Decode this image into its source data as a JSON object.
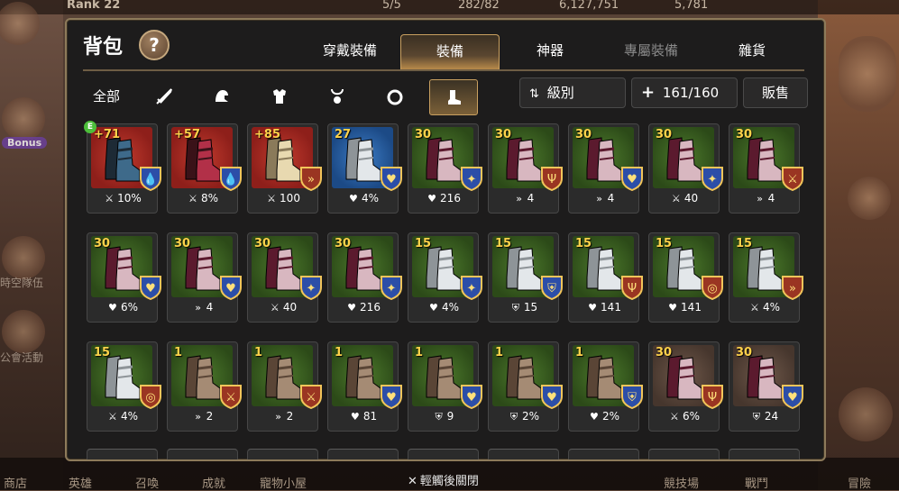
{
  "topbar": {
    "rank": "Rank 22",
    "stamina": "5/5",
    "currency1": "282/82",
    "gold": "6,127,751",
    "gems": "5,781"
  },
  "side_left": [
    {
      "label": "Bonus"
    },
    {
      "label": "時空隊伍"
    },
    {
      "label": "公會活動"
    }
  ],
  "bottom_nav": [
    "商店",
    "英雄",
    "召喚",
    "成就",
    "寵物小屋",
    "競技場",
    "戰鬥",
    "冒險"
  ],
  "close_hint": "輕觸後關閉",
  "panel": {
    "title": "背包",
    "help": "?",
    "tabs": [
      {
        "label": "穿戴裝備",
        "state": "normal"
      },
      {
        "label": "裝備",
        "state": "active"
      },
      {
        "label": "神器",
        "state": "normal"
      },
      {
        "label": "專屬裝備",
        "state": "dim"
      },
      {
        "label": "雜貨",
        "state": "normal"
      }
    ],
    "filters": {
      "all_label": "全部",
      "icons": [
        "weapon-icon",
        "helmet-icon",
        "armor-icon",
        "necklace-icon",
        "ring-icon",
        "boots-icon"
      ],
      "active": "boots-icon"
    },
    "sort_label": "級別",
    "capacity": "161/160",
    "sell_label": "販售"
  },
  "colors": {
    "accent": "#c9a060",
    "level": "#ffd24a",
    "blue_set": "#3f63c0",
    "red_set": "#b0442a"
  },
  "items": [
    {
      "level": "71",
      "bg": "red",
      "boot": "dark",
      "set": "blue",
      "set_icon": "drop",
      "stat_icon": "sword",
      "stat": "10%",
      "equipped": true,
      "plus": true
    },
    {
      "level": "57",
      "bg": "red",
      "boot": "crimson",
      "set": "blue",
      "set_icon": "drop",
      "stat_icon": "sword",
      "stat": "8%",
      "plus": true
    },
    {
      "level": "85",
      "bg": "red",
      "boot": "gold",
      "set": "red",
      "set_icon": "arrow",
      "stat_icon": "sword",
      "stat": "100",
      "plus": true
    },
    {
      "level": "27",
      "bg": "blue",
      "boot": "silver",
      "set": "blue",
      "set_icon": "heart",
      "stat_icon": "heart",
      "stat": "4%"
    },
    {
      "level": "30",
      "bg": "green",
      "boot": "maroon",
      "set": "blue",
      "set_icon": "star",
      "stat_icon": "heart",
      "stat": "216"
    },
    {
      "level": "30",
      "bg": "green",
      "boot": "maroon",
      "set": "red",
      "set_icon": "trident",
      "stat_icon": "arrow",
      "stat": "4"
    },
    {
      "level": "30",
      "bg": "green",
      "boot": "maroon",
      "set": "blue",
      "set_icon": "heart",
      "stat_icon": "arrow",
      "stat": "4"
    },
    {
      "level": "30",
      "bg": "green",
      "boot": "maroon",
      "set": "blue",
      "set_icon": "star",
      "stat_icon": "sword",
      "stat": "40"
    },
    {
      "level": "30",
      "bg": "green",
      "boot": "maroon",
      "set": "red",
      "set_icon": "sword",
      "stat_icon": "arrow",
      "stat": "4"
    },
    {
      "level": "30",
      "bg": "green",
      "boot": "maroon",
      "set": "blue",
      "set_icon": "heart",
      "stat_icon": "heart",
      "stat": "6%"
    },
    {
      "level": "30",
      "bg": "green",
      "boot": "maroon",
      "set": "blue",
      "set_icon": "heart",
      "stat_icon": "arrow",
      "stat": "4"
    },
    {
      "level": "30",
      "bg": "green",
      "boot": "maroon",
      "set": "blue",
      "set_icon": "star",
      "stat_icon": "sword",
      "stat": "40"
    },
    {
      "level": "30",
      "bg": "green",
      "boot": "maroon",
      "set": "blue",
      "set_icon": "star",
      "stat_icon": "heart",
      "stat": "216"
    },
    {
      "level": "15",
      "bg": "green",
      "boot": "silver",
      "set": "blue",
      "set_icon": "star",
      "stat_icon": "heart",
      "stat": "4%"
    },
    {
      "level": "15",
      "bg": "green",
      "boot": "silver",
      "set": "blue",
      "set_icon": "shield",
      "stat_icon": "shield",
      "stat": "15"
    },
    {
      "level": "15",
      "bg": "green",
      "boot": "silver",
      "set": "red",
      "set_icon": "trident",
      "stat_icon": "heart",
      "stat": "141"
    },
    {
      "level": "15",
      "bg": "green",
      "boot": "silver",
      "set": "red",
      "set_icon": "target",
      "stat_icon": "heart",
      "stat": "141"
    },
    {
      "level": "15",
      "bg": "green",
      "boot": "silver",
      "set": "red",
      "set_icon": "arrow",
      "stat_icon": "sword",
      "stat": "4%"
    },
    {
      "level": "15",
      "bg": "green",
      "boot": "silver",
      "set": "red",
      "set_icon": "target",
      "stat_icon": "sword",
      "stat": "4%"
    },
    {
      "level": "1",
      "bg": "green",
      "boot": "brown",
      "set": "red",
      "set_icon": "sword",
      "stat_icon": "arrow",
      "stat": "2"
    },
    {
      "level": "1",
      "bg": "green",
      "boot": "brown",
      "set": "red",
      "set_icon": "sword",
      "stat_icon": "arrow",
      "stat": "2"
    },
    {
      "level": "1",
      "bg": "green",
      "boot": "brown",
      "set": "blue",
      "set_icon": "heart",
      "stat_icon": "heart",
      "stat": "81"
    },
    {
      "level": "1",
      "bg": "green",
      "boot": "brown",
      "set": "blue",
      "set_icon": "heart",
      "stat_icon": "shield",
      "stat": "9"
    },
    {
      "level": "1",
      "bg": "green",
      "boot": "brown",
      "set": "blue",
      "set_icon": "heart",
      "stat_icon": "shield",
      "stat": "2%"
    },
    {
      "level": "1",
      "bg": "green",
      "boot": "brown",
      "set": "blue",
      "set_icon": "shield",
      "stat_icon": "heart",
      "stat": "2%"
    },
    {
      "level": "30",
      "bg": "brown",
      "boot": "maroon",
      "set": "red",
      "set_icon": "trident",
      "stat_icon": "sword",
      "stat": "6%"
    },
    {
      "level": "30",
      "bg": "brown",
      "boot": "maroon",
      "set": "blue",
      "set_icon": "heart",
      "stat_icon": "shield",
      "stat": "24"
    }
  ]
}
